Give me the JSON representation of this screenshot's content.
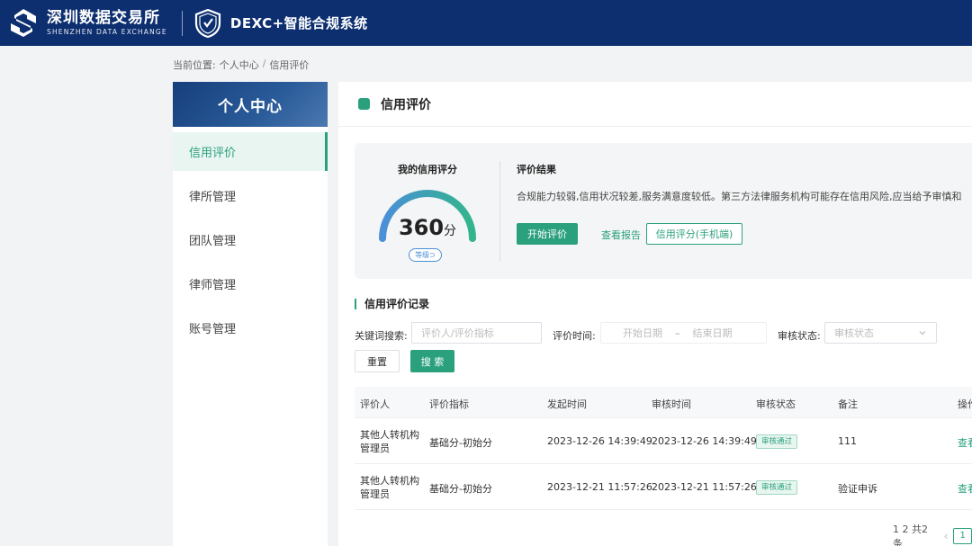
{
  "header": {
    "brand_cn": "深圳数据交易所",
    "brand_en": "SHENZHEN DATA EXCHANGE",
    "system_title": "DEXC+智能合规系统",
    "bg_color": "#0d2f6f"
  },
  "breadcrumb": {
    "prefix": "当前位置:",
    "items": [
      "个人中心",
      "信用评价"
    ],
    "sep": "/"
  },
  "sidebar": {
    "title": "个人中心",
    "items": [
      {
        "label": "信用评价",
        "active": true
      },
      {
        "label": "律所管理"
      },
      {
        "label": "团队管理"
      },
      {
        "label": "律师管理"
      },
      {
        "label": "账号管理"
      }
    ]
  },
  "panel": {
    "title": "信用评价"
  },
  "score": {
    "label": "我的信用评分",
    "value": "360",
    "unit": "分",
    "level_label": "等级",
    "level_icon": "help-circle-icon",
    "gauge_fraction": 0.36
  },
  "result": {
    "title": "评价结果",
    "text": "合规能力较弱,信用状况较差,服务满意度较低。第三方法律服务机构可能存在信用风险,应当给予审慎和",
    "start_button": "开始评价",
    "report_link": "查看报告",
    "mobile_button": "信用评分(手机端)"
  },
  "records": {
    "title": "信用评价记录",
    "filters": {
      "keyword_label": "关键词搜索:",
      "keyword_placeholder": "评价人/评价指标",
      "time_label": "评价时间:",
      "start_placeholder": "开始日期",
      "range_sep": "–",
      "end_placeholder": "结束日期",
      "status_label": "审核状态:",
      "status_placeholder": "审核状态"
    },
    "reset_button": "重置",
    "search_button": "搜 索",
    "columns": [
      "评价人",
      "评价指标",
      "发起时间",
      "审核时间",
      "审核状态",
      "备注",
      "操作"
    ],
    "rows": [
      {
        "evaluator": "其他人转机构管理员",
        "indicator": "基础分-初始分",
        "start_time": "2023-12-26 14:39:49",
        "audit_time": "2023-12-26 14:39:49",
        "status": "审核通过",
        "remark": "111",
        "action": "查看"
      },
      {
        "evaluator": "其他人转机构管理员",
        "indicator": "基础分-初始分",
        "start_time": "2023-12-21 11:57:26",
        "audit_time": "2023-12-21 11:57:26",
        "status": "审核通过",
        "remark": "验证申诉",
        "action": "查看"
      }
    ]
  },
  "pagination": {
    "summary": "1 2 共2条",
    "current_page": "1"
  },
  "colors": {
    "accent": "#2ba07d",
    "gauge_start": "#4a8fd8",
    "gauge_end": "#33b58c"
  }
}
